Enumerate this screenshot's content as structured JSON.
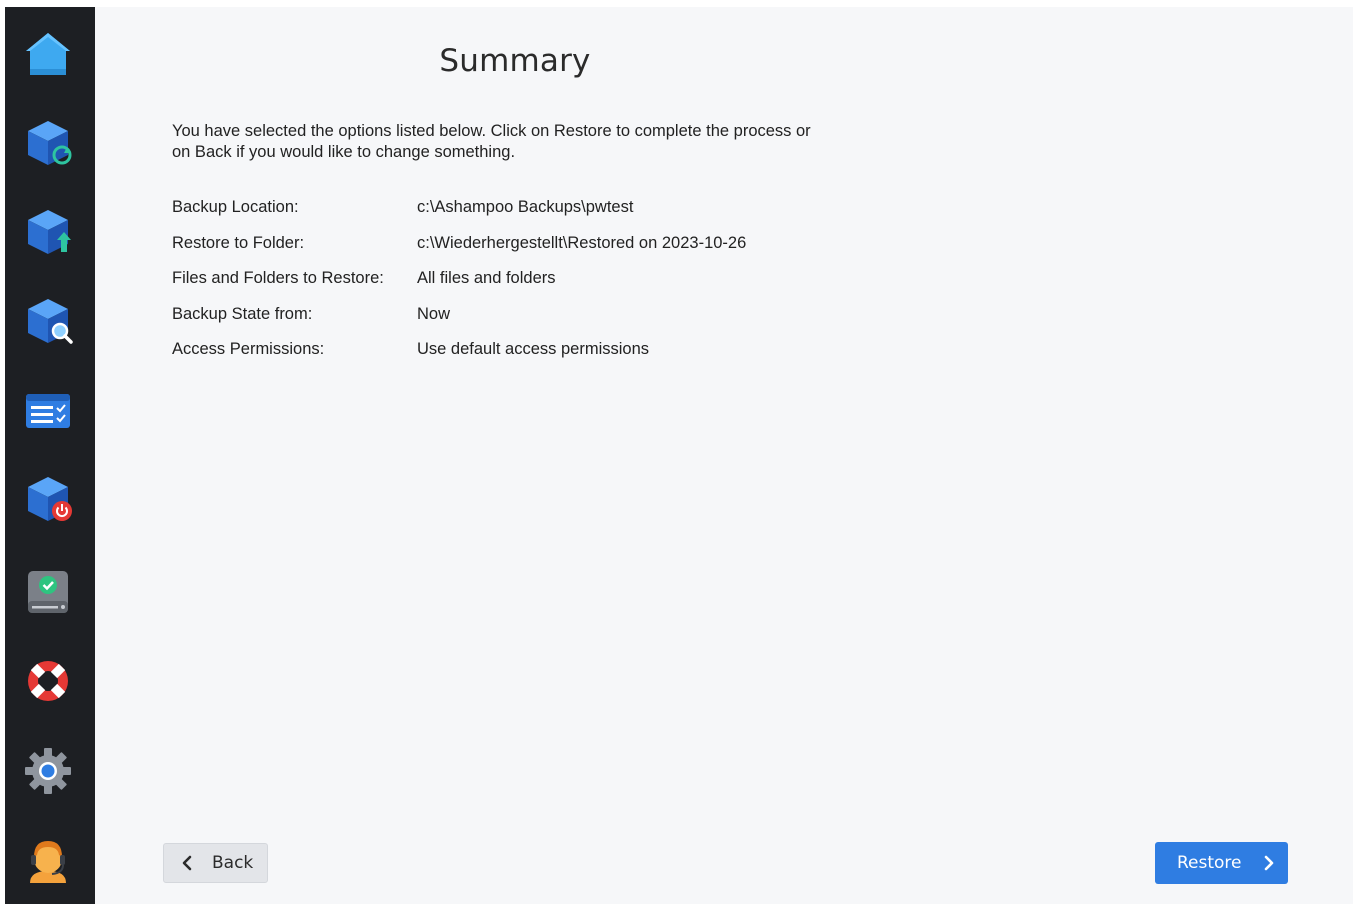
{
  "sidebar": {
    "items": [
      {
        "icon": "home-icon"
      },
      {
        "icon": "backup-sync-icon"
      },
      {
        "icon": "backup-upload-icon"
      },
      {
        "icon": "backup-search-icon"
      },
      {
        "icon": "task-list-icon"
      },
      {
        "icon": "backup-power-icon"
      },
      {
        "icon": "drive-check-icon"
      },
      {
        "icon": "lifebuoy-icon"
      },
      {
        "icon": "gear-icon"
      },
      {
        "icon": "support-agent-icon"
      }
    ]
  },
  "main": {
    "title": "Summary",
    "intro_line1": "You have selected the options listed below. Click on Restore to complete the process or",
    "intro_line2": "on Back if you would like to change something.",
    "rows": [
      {
        "label": "Backup Location:",
        "value": "c:\\Ashampoo Backups\\pwtest"
      },
      {
        "label": "Restore to Folder:",
        "value": "c:\\Wiederhergestellt\\Restored on 2023-10-26"
      },
      {
        "label": "Files and Folders to Restore:",
        "value": "All files and folders"
      },
      {
        "label": "Backup State from:",
        "value": "Now"
      },
      {
        "label": "Access Permissions:",
        "value": "Use default access permissions"
      }
    ]
  },
  "footer": {
    "back_label": "Back",
    "restore_label": "Restore"
  },
  "colors": {
    "accent": "#2f7de2",
    "sidebar_bg": "#1d1f23",
    "page_bg": "#f6f7f9"
  }
}
